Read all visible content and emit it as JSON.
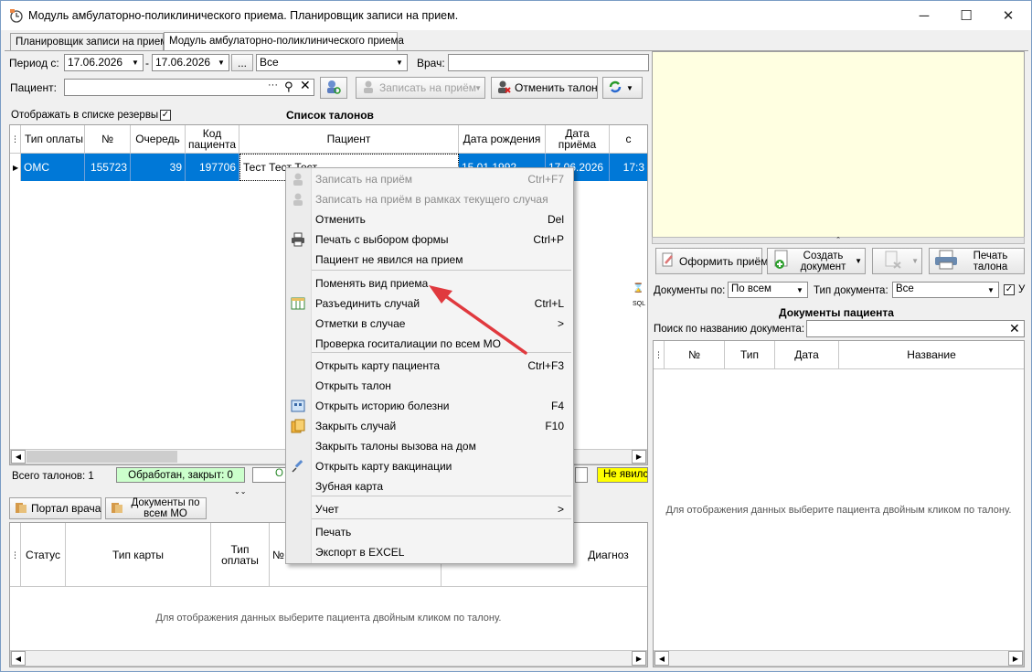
{
  "window": {
    "title": "Модуль амбулаторно-поликлинического приема. Планировщик записи на прием.",
    "min": "─",
    "max": "☐",
    "close": "✕"
  },
  "tabs": [
    "Планировщик записи на прием",
    "Модуль амбулаторно-поликлинического приема"
  ],
  "filters": {
    "period_label": "Период с:",
    "date_from": "17.06.2026",
    "dash": "-",
    "date_to": "17.06.2026",
    "ellipsis": "...",
    "type_value": "Все",
    "doctor_label": "Врач:",
    "patient_label": "Пациент:",
    "patient_value": "",
    "picker": "···"
  },
  "toolbar": {
    "record_label": "Записать на приём",
    "cancel_ticket_label": "Отменить талон"
  },
  "talons": {
    "show_reserves_label": "Отображать в списке резервы",
    "section_title": "Список талонов",
    "columns": [
      "Тип оплаты",
      "№",
      "Очередь",
      "Код пациента",
      "Пациент",
      "Дата рождения",
      "Дата приёма",
      "с"
    ],
    "row": {
      "pay": "ОМС",
      "num": "155723",
      "queue": "39",
      "code": "197706",
      "patient": "Тест Тест Тест",
      "birth": "15.01.1992",
      "date": "17.06.2026",
      "time": "17:3"
    }
  },
  "status": {
    "total": "Всего талонов: 1",
    "processed": "Обработан, закрыт: 0",
    "partial": "О",
    "no_show": "Не явился"
  },
  "bottom_left": {
    "portal_label": "Портал врача",
    "docs_mo_label": "Документы по всем МО",
    "columns": [
      "Статус",
      "Тип карты",
      "Тип оплаты",
      "№",
      "Диагноз"
    ],
    "empty_text": "Для отображения данных выберите пациента двойным кликом по талону."
  },
  "right": {
    "make_reception": "Оформить приём",
    "create_doc": "Создать документ",
    "print_ticket": "Печать талона",
    "sql_label": "SQL",
    "docs_by_label": "Документы по:",
    "docs_by_value": "По всем",
    "doc_type_label": "Тип документа:",
    "doc_type_value": "Все",
    "check_label": "У",
    "docs_title": "Документы пациента",
    "search_label": "Поиск по названию документа:",
    "columns": [
      "№",
      "Тип",
      "Дата",
      "Название"
    ],
    "empty_text": "Для отображения данных выберите пациента двойным кликом по талону."
  },
  "context_menu": {
    "items": [
      {
        "label": "Записать на приём",
        "shortcut": "Ctrl+F7",
        "disabled": true,
        "icon": "person-add-icon"
      },
      {
        "label": "Записать на приём в рамках текущего случая",
        "shortcut": "",
        "disabled": true,
        "icon": "person-add-icon"
      },
      {
        "label": "Отменить",
        "shortcut": "Del",
        "disabled": false,
        "icon": ""
      },
      {
        "label": "Печать с выбором формы",
        "shortcut": "Ctrl+P",
        "disabled": false,
        "icon": "printer-icon"
      },
      {
        "label": "Пациент не явился на прием",
        "shortcut": "",
        "disabled": false,
        "icon": ""
      },
      {
        "label": "Поменять вид приема",
        "shortcut": "",
        "disabled": false,
        "icon": ""
      },
      {
        "label": "Разъединить случай",
        "shortcut": "Ctrl+L",
        "disabled": false,
        "icon": "table-icon"
      },
      {
        "label": "Отметки в случае",
        "shortcut": ">",
        "disabled": false,
        "icon": ""
      },
      {
        "label": "Проверка госиталиации по всем МО",
        "shortcut": "",
        "disabled": false,
        "icon": ""
      },
      {
        "label": "Открыть карту пациента",
        "shortcut": "Ctrl+F3",
        "disabled": false,
        "icon": ""
      },
      {
        "label": "Открыть талон",
        "shortcut": "",
        "disabled": false,
        "icon": ""
      },
      {
        "label": "Открыть историю болезни",
        "shortcut": "F4",
        "disabled": false,
        "icon": "history-icon"
      },
      {
        "label": "Закрыть случай",
        "shortcut": "F10",
        "disabled": false,
        "icon": "close-case-icon"
      },
      {
        "label": "Закрыть талоны вызова на дом",
        "shortcut": "",
        "disabled": false,
        "icon": ""
      },
      {
        "label": "Открыть карту вакцинации",
        "shortcut": "",
        "disabled": false,
        "icon": "syringe-icon"
      },
      {
        "label": "Зубная карта",
        "shortcut": "",
        "disabled": false,
        "icon": ""
      },
      {
        "label": "Учет",
        "shortcut": ">",
        "disabled": false,
        "icon": ""
      },
      {
        "label": "Печать",
        "shortcut": "",
        "disabled": false,
        "icon": ""
      },
      {
        "label": "Экспорт в EXCEL",
        "shortcut": "",
        "disabled": false,
        "icon": ""
      }
    ]
  },
  "colors": {
    "selection": "#0078d7",
    "note_panel": "#ffffe1",
    "processed_bg": "#ccffcc",
    "no_show_bg": "#ffff00",
    "arrow": "#e0393e"
  }
}
